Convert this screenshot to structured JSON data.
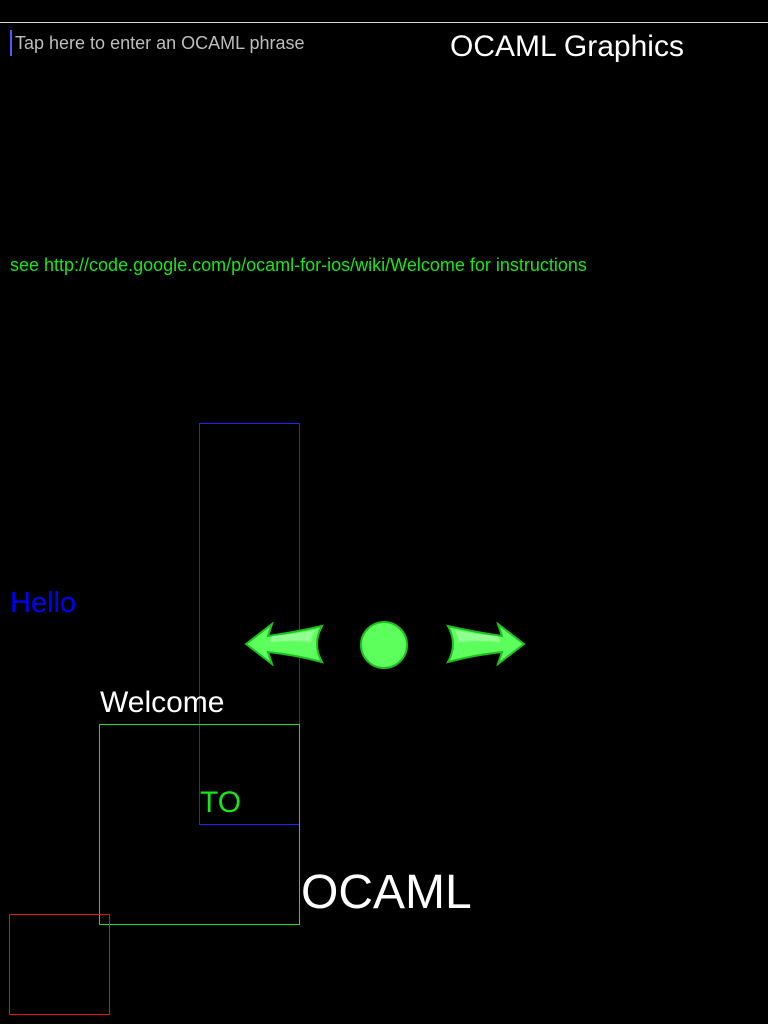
{
  "input": {
    "placeholder": "Tap here to enter an OCAML phrase"
  },
  "header": {
    "title": "OCAML Graphics"
  },
  "instructions": "see http://code.google.com/p/ocaml-for-ios/wiki/Welcome for instructions",
  "canvas": {
    "hello": "Hello",
    "welcome": "Welcome",
    "to": "TO",
    "ocaml": "OCAML"
  },
  "controls": {
    "left_icon": "arrow-left-icon",
    "center_icon": "circle-icon",
    "right_icon": "arrow-right-icon",
    "color": "#5cff5c"
  },
  "colors": {
    "background": "#000000",
    "green": "#19e619",
    "blue": "#0000ff",
    "red": "#e01414",
    "white": "#ffffff"
  }
}
